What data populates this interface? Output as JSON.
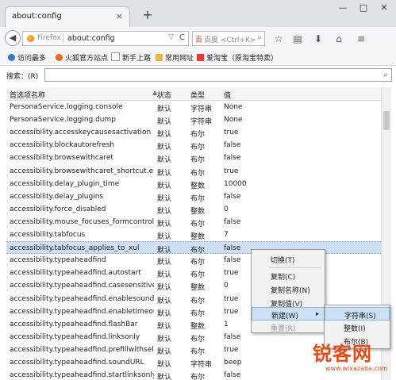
{
  "window": {
    "tab_title": "about:config",
    "tab_close": "×",
    "new_tab": "+",
    "controls": [
      "—",
      "□",
      "✕"
    ]
  },
  "navbar": {
    "back_icon": "◀",
    "identity_label": "Firefox",
    "url": "about:config",
    "url_dropdown": "▽",
    "reload_icon": "C",
    "search_engine_icon": "百",
    "search_placeholder": "百度 <Ctrl+K>",
    "search_icon": "⌕",
    "icons": [
      "star-icon",
      "reading-list-icon",
      "download-icon",
      "home-icon",
      "menu-icon"
    ],
    "icon_glyphs": [
      "☆",
      "▤",
      "⬇",
      "⌂",
      "≡"
    ]
  },
  "bookmarks": [
    {
      "label": "访问最多",
      "icon": "gear-icon",
      "color": "#3c78c8"
    },
    {
      "label": "火狐官方站点",
      "icon": "firefox-icon",
      "color": "#e66b1a"
    },
    {
      "label": "新手上路",
      "icon": "page-icon",
      "color": "#ffffff"
    },
    {
      "label": "常用网址",
      "icon": "folder-icon",
      "color": "#e8b84a"
    },
    {
      "label": "爱淘宝（原淘宝特卖）",
      "icon": "taobao-icon",
      "color": "#e53935"
    }
  ],
  "filter": {
    "label": "搜索：(R)",
    "value": "",
    "icon": "⌕"
  },
  "table": {
    "columns": [
      "首选项名称",
      "状态",
      "类型",
      "值"
    ],
    "rows": [
      [
        "PersonaService.logging.console",
        "默认",
        "字符串",
        "None"
      ],
      [
        "PersonaService.logging.dump",
        "默认",
        "字符串",
        "None"
      ],
      [
        "accessibility.accesskeycausesactivation",
        "默认",
        "布尔",
        "true"
      ],
      [
        "accessibility.blockautorefresh",
        "默认",
        "布尔",
        "false"
      ],
      [
        "accessibility.browsewithcaret",
        "默认",
        "布尔",
        "false"
      ],
      [
        "accessibility.browsewithcaret_shortcut.en...",
        "默认",
        "布尔",
        "true"
      ],
      [
        "accessibility.delay_plugin_time",
        "默认",
        "整数",
        "10000"
      ],
      [
        "accessibility.delay_plugins",
        "默认",
        "布尔",
        "false"
      ],
      [
        "accessibility.force_disabled",
        "默认",
        "整数",
        "0"
      ],
      [
        "accessibility.mouse_focuses_formcontrol",
        "默认",
        "布尔",
        "false"
      ],
      [
        "accessibility.tabfocus",
        "默认",
        "整数",
        "7"
      ],
      [
        "accessibility.tabfocus_applies_to_xul",
        "默认",
        "布尔",
        "false"
      ],
      [
        "accessibility.typeaheadfind",
        "默认",
        "布尔",
        "false"
      ],
      [
        "accessibility.typeaheadfind.autostart",
        "默认",
        "布尔",
        "true"
      ],
      [
        "accessibility.typeaheadfind.casesensitive",
        "默认",
        "整数",
        "0"
      ],
      [
        "accessibility.typeaheadfind.enablesound",
        "默认",
        "布尔",
        "true"
      ],
      [
        "accessibility.typeaheadfind.enabletimeout",
        "默认",
        "布尔",
        "true"
      ],
      [
        "accessibility.typeaheadfind.flashBar",
        "默认",
        "整数",
        "1"
      ],
      [
        "accessibility.typeaheadfind.linksonly",
        "默认",
        "布尔",
        "false"
      ],
      [
        "accessibility.typeaheadfind.prefillwithsele...",
        "默认",
        "布尔",
        "true"
      ],
      [
        "accessibility.typeaheadfind.soundURL",
        "默认",
        "字符串",
        "beep"
      ],
      [
        "accessibility.typeaheadfind.startlinksonly",
        "默认",
        "布尔",
        "false"
      ]
    ],
    "selected_row": 11
  },
  "context_menu": {
    "items": [
      {
        "label": "切换(T)",
        "state": "normal"
      },
      {
        "label": "复制(C)",
        "state": "normal"
      },
      {
        "label": "复制名称(N)",
        "state": "normal"
      },
      {
        "label": "复制值(V)",
        "state": "normal"
      },
      {
        "label": "新建(W)",
        "state": "highlighted",
        "arrow": "▸"
      },
      {
        "label": "重置(R)",
        "state": "disabled"
      }
    ]
  },
  "submenu": {
    "items": [
      {
        "label": "字符串(S)",
        "state": "highlighted"
      },
      {
        "label": "整数(I)",
        "state": "normal"
      },
      {
        "label": "布尔(B)",
        "state": "normal"
      }
    ]
  },
  "watermark": {
    "main": "锐客网",
    "sub": "www.wlxazaba.com"
  },
  "colors": {
    "accent": "#3c78c8",
    "selection": "#cfe0f4",
    "watermark": "#e64a19"
  }
}
